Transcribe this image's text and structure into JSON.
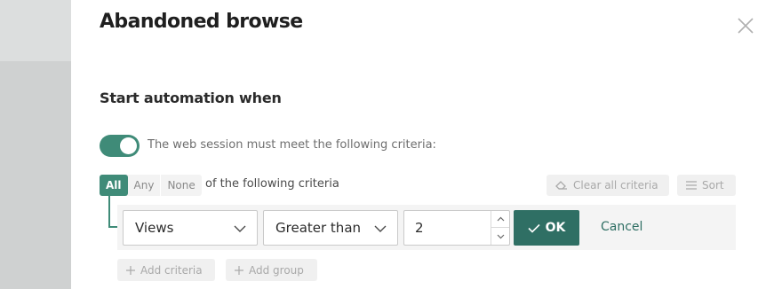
{
  "modal": {
    "title": "Abandoned browse"
  },
  "trigger": {
    "heading": "Start automation when",
    "toggle_on": true,
    "toggle_label": "The web session must meet the following criteria:"
  },
  "match": {
    "options": [
      "All",
      "Any",
      "None"
    ],
    "selected": "All",
    "suffix": "of the following criteria"
  },
  "toolbar": {
    "clear_label": "Clear all criteria",
    "sort_label": "Sort"
  },
  "criterion": {
    "field": "Views",
    "operator": "Greater than",
    "value": "2",
    "ok_label": "OK",
    "cancel_label": "Cancel"
  },
  "actions": {
    "add_criteria_label": "Add criteria",
    "add_group_label": "Add group"
  },
  "colors": {
    "accent": "#3f8b78",
    "ok_button": "#2f6f64"
  }
}
